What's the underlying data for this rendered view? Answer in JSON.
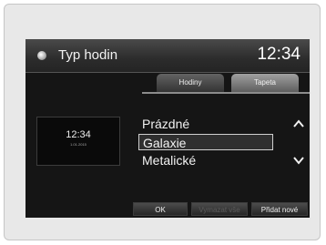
{
  "header": {
    "title": "Typ hodin",
    "clock": "12:34"
  },
  "tabs": [
    {
      "label": "Hodiny",
      "active": false
    },
    {
      "label": "Tapeta",
      "active": true
    }
  ],
  "preview": {
    "time": "12:34",
    "date": "1.01.2015"
  },
  "wallpaper_list": {
    "items": [
      "Prázdné",
      "Galaxie",
      "Metalické"
    ],
    "selected_index": 1
  },
  "buttons": {
    "ok": "OK",
    "clear": "Vymazat vše",
    "add_new": "Přidat nové"
  },
  "icons": {
    "menu": "menu-dot-icon",
    "scroll_up": "chevron-up-icon",
    "scroll_down": "chevron-down-icon"
  }
}
